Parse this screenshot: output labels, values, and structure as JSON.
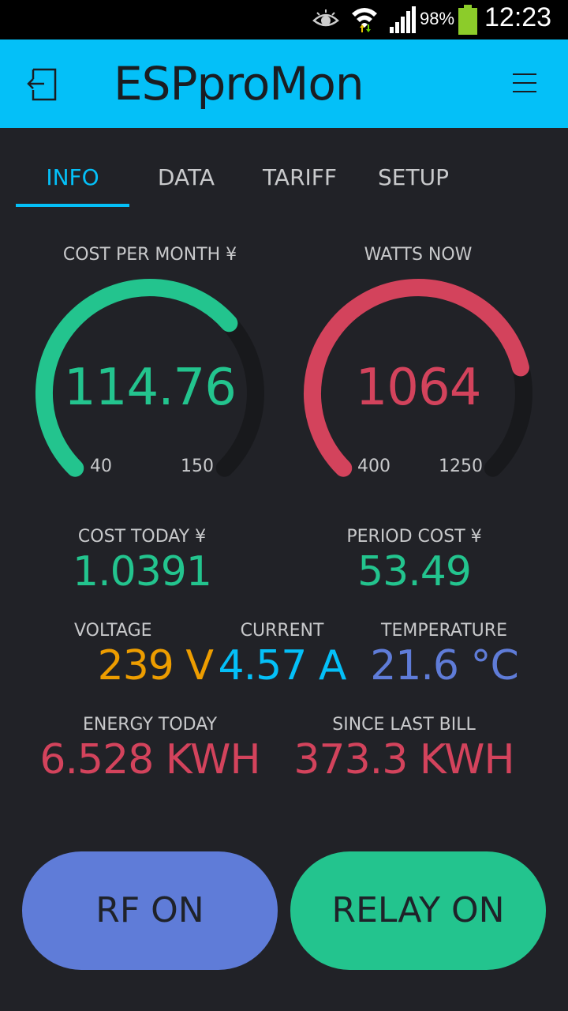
{
  "status": {
    "battery": "98%",
    "time": "12:23",
    "icons": [
      "eye-icon",
      "wifi-icon",
      "signal-icon",
      "battery-icon"
    ]
  },
  "app": {
    "title": "ESPproMon",
    "back_icon": "exit-icon",
    "menu_icon": "hamburger-menu-icon"
  },
  "tabs": [
    {
      "label": "INFO",
      "active": true
    },
    {
      "label": "DATA",
      "active": false
    },
    {
      "label": "TARIFF",
      "active": false
    },
    {
      "label": "SETUP",
      "active": false
    }
  ],
  "gauges": {
    "cost_per_month": {
      "label": "COST PER MONTH ¥",
      "value": "114.76",
      "min": "40",
      "max": "150",
      "numeric": 114.76,
      "lo": 40,
      "hi": 150,
      "color": "#23c48e"
    },
    "watts_now": {
      "label": "WATTS NOW",
      "value": "1064",
      "min": "400",
      "max": "1250",
      "numeric": 1064,
      "lo": 400,
      "hi": 1250,
      "color": "#d3435c"
    }
  },
  "metrics": {
    "cost_today": {
      "label": "COST TODAY ¥",
      "value": "1.0391",
      "color": "#23c48e"
    },
    "period_cost": {
      "label": "PERIOD COST ¥",
      "value": "53.49",
      "color": "#23c48e"
    },
    "voltage": {
      "label": "VOLTAGE",
      "value": "239 V",
      "color": "#ed9d00"
    },
    "current": {
      "label": "CURRENT",
      "value": "4.57 A",
      "color": "#04c0f8"
    },
    "temperature": {
      "label": "TEMPERATURE",
      "value": "21.6 °C",
      "color": "#5f7cd8"
    },
    "energy_today": {
      "label": "ENERGY TODAY",
      "value": "6.528 KWH",
      "color": "#d3435c"
    },
    "since_last_bill": {
      "label": "SINCE LAST BILL",
      "value": "373.3 KWH",
      "color": "#d3435c"
    }
  },
  "buttons": {
    "rf": {
      "label": "RF ON",
      "color": "#5f7cd8"
    },
    "relay": {
      "label": "RELAY ON",
      "color": "#23c48e"
    }
  },
  "colors": {
    "accent": "#04c0f8",
    "background": "#212227",
    "gauge_track": "#18191c"
  }
}
